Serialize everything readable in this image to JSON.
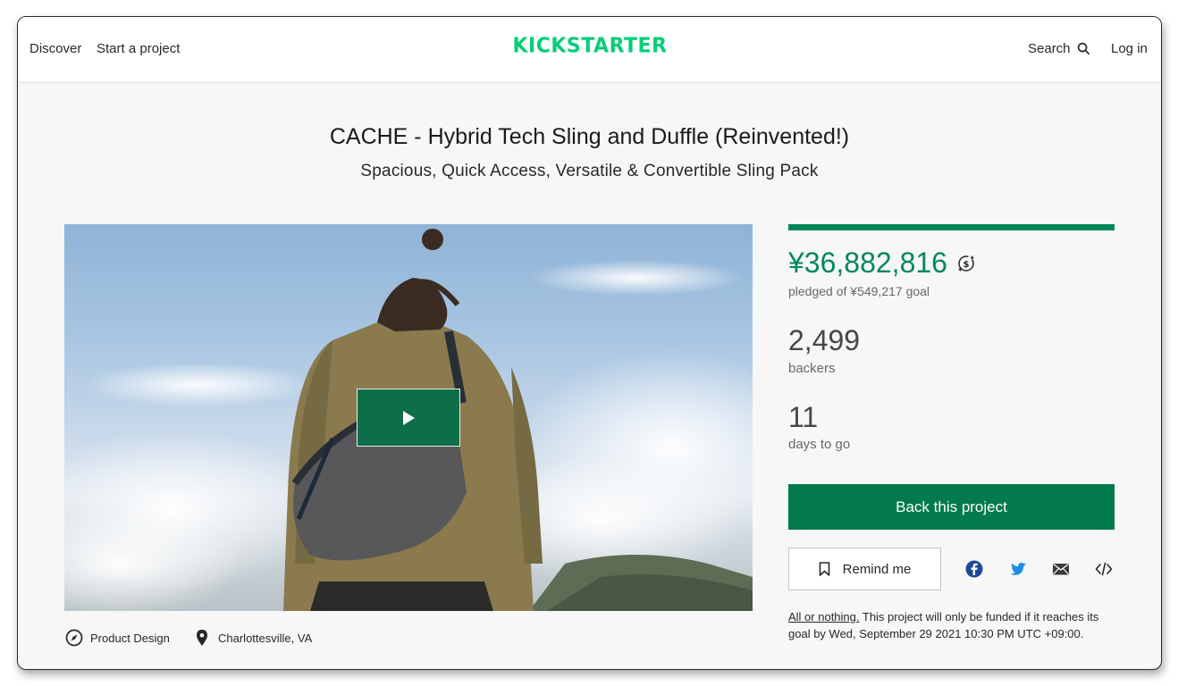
{
  "header": {
    "nav": {
      "discover": "Discover",
      "start_project": "Start a project"
    },
    "logo_text": "KICKSTARTER",
    "search_label": "Search",
    "login_label": "Log in"
  },
  "project": {
    "title": "CACHE - Hybrid Tech Sling and Duffle (Reinvented!)",
    "blurb": "Spacious, Quick Access, Versatile & Convertible Sling Pack",
    "category": "Product Design",
    "location": "Charlottesville, VA"
  },
  "stats": {
    "pledged": "¥36,882,816",
    "goal_text": "pledged of ¥549,217 goal",
    "backers": "2,499",
    "backers_label": "backers",
    "days": "11",
    "days_label": "days to go",
    "progress_fraction": 1.0
  },
  "actions": {
    "back_label": "Back this project",
    "remind_label": "Remind me"
  },
  "funding_note": {
    "link": "All or nothing.",
    "text": " This project will only be funded if it reaches its goal by Wed, September 29 2021 10:30 PM UTC +09:00."
  },
  "icons": {
    "currency": "currency-convert-icon",
    "category": "compass-icon",
    "location": "location-pin-icon",
    "bookmark": "bookmark-icon",
    "facebook": "facebook-icon",
    "twitter": "twitter-icon",
    "email": "email-icon",
    "embed": "embed-code-icon",
    "play": "play-icon",
    "search": "search-icon"
  },
  "colors": {
    "brand_green": "#05ce78",
    "action_green": "#037a4b",
    "pledged_green": "#028858",
    "facebook_blue": "#1877f2",
    "twitter_blue": "#1da1f2"
  }
}
